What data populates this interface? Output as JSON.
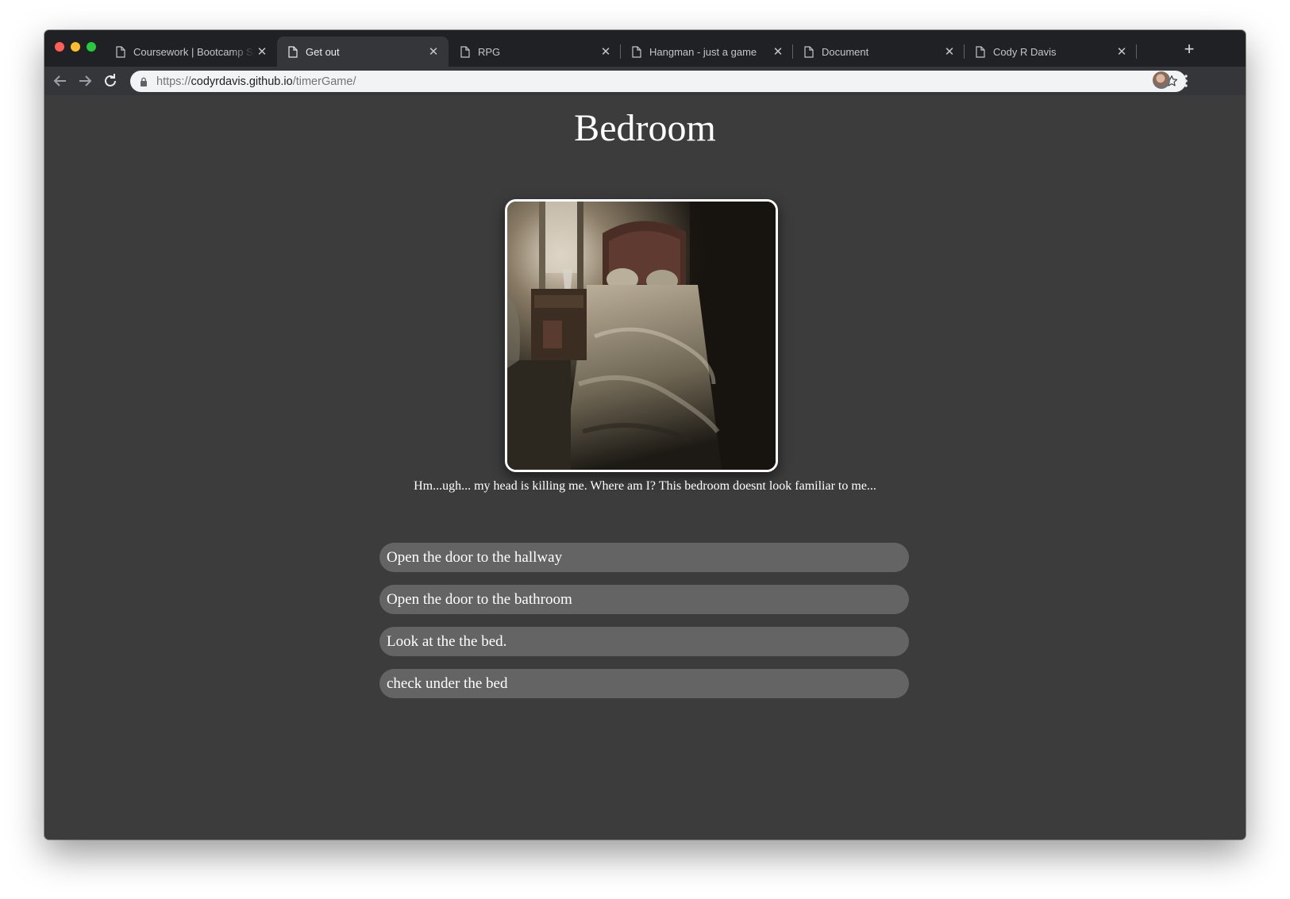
{
  "browser": {
    "tabs": [
      {
        "title": "Coursework | Bootcamp Spot",
        "active": false
      },
      {
        "title": "Get out",
        "active": true
      },
      {
        "title": "RPG",
        "active": false
      },
      {
        "title": "Hangman - just a game",
        "active": false
      },
      {
        "title": "Document",
        "active": false
      },
      {
        "title": "Cody R Davis",
        "active": false
      }
    ],
    "address_bar": {
      "scheme": "https://",
      "host": "codyrdavis.github.io",
      "path": "/timerGame/"
    },
    "icons": {
      "back": "arrow-left-icon",
      "forward": "arrow-right-icon",
      "reload": "reload-icon",
      "secure": "lock-icon",
      "bookmark": "star-icon",
      "new_tab": "plus-icon",
      "menu": "kebab-menu-icon"
    }
  },
  "game": {
    "room_title": "Bedroom",
    "narration": "Hm...ugh... my head is killing me. Where am I? This bedroom doesnt look familiar to me...",
    "choices": [
      "Open the door to the hallway",
      "Open the door to the bathroom",
      "Look at the the bed.",
      "check under the bed"
    ]
  },
  "colors": {
    "page_background": "#3c3c3c",
    "choice_background": "#646464",
    "text": "#ffffff",
    "tabstrip": "#202124",
    "toolbar": "#35363a"
  }
}
